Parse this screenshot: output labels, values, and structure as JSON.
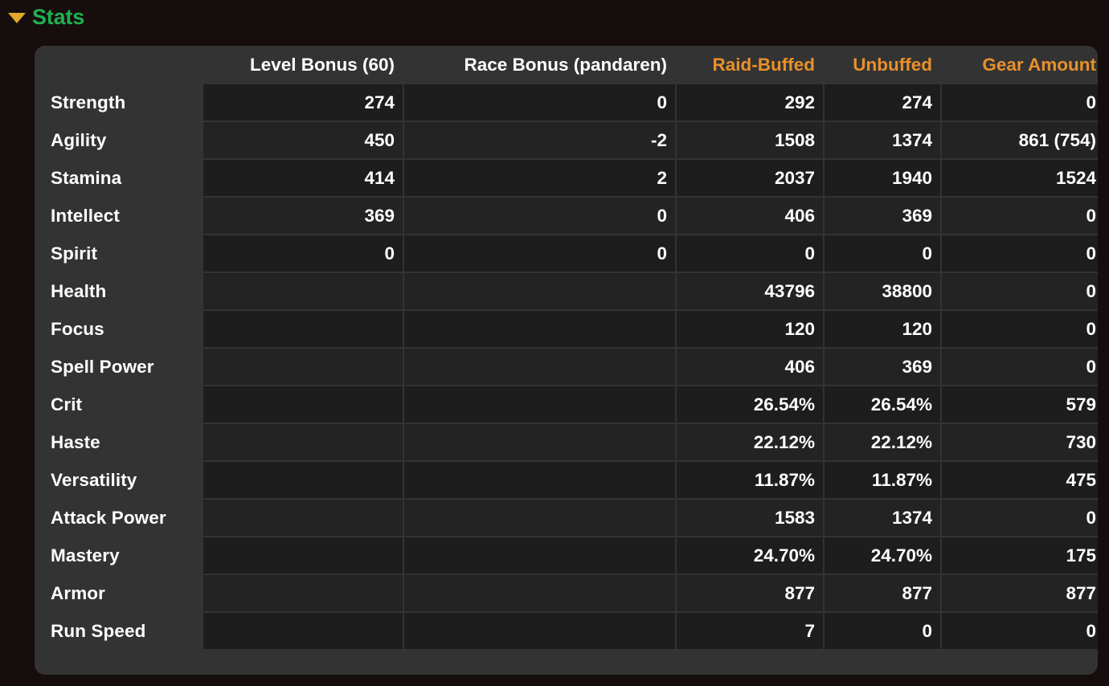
{
  "section": {
    "title": "Stats",
    "collapse_icon": "triangle-down-icon",
    "title_color": "#21b04f",
    "icon_color": "#e3a72a"
  },
  "table": {
    "columns": [
      {
        "label": "",
        "color": ""
      },
      {
        "label": "Level Bonus (60)",
        "color": "#ffffff"
      },
      {
        "label": "Race Bonus (pandaren)",
        "color": "#ffffff"
      },
      {
        "label": "Raid-Buffed",
        "color": "#e8912a"
      },
      {
        "label": "Unbuffed",
        "color": "#e8912a"
      },
      {
        "label": "Gear Amount",
        "color": "#e8912a"
      }
    ],
    "rows": [
      {
        "label": "Strength",
        "level_bonus": "274",
        "race_bonus": "0",
        "raid_buffed": "292",
        "unbuffed": "274",
        "gear_amount": "0"
      },
      {
        "label": "Agility",
        "level_bonus": "450",
        "race_bonus": "-2",
        "raid_buffed": "1508",
        "unbuffed": "1374",
        "gear_amount": "861 (754)"
      },
      {
        "label": "Stamina",
        "level_bonus": "414",
        "race_bonus": "2",
        "raid_buffed": "2037",
        "unbuffed": "1940",
        "gear_amount": "1524"
      },
      {
        "label": "Intellect",
        "level_bonus": "369",
        "race_bonus": "0",
        "raid_buffed": "406",
        "unbuffed": "369",
        "gear_amount": "0"
      },
      {
        "label": "Spirit",
        "level_bonus": "0",
        "race_bonus": "0",
        "raid_buffed": "0",
        "unbuffed": "0",
        "gear_amount": "0"
      },
      {
        "label": "Health",
        "level_bonus": "",
        "race_bonus": "",
        "raid_buffed": "43796",
        "unbuffed": "38800",
        "gear_amount": "0"
      },
      {
        "label": "Focus",
        "level_bonus": "",
        "race_bonus": "",
        "raid_buffed": "120",
        "unbuffed": "120",
        "gear_amount": "0"
      },
      {
        "label": "Spell Power",
        "level_bonus": "",
        "race_bonus": "",
        "raid_buffed": "406",
        "unbuffed": "369",
        "gear_amount": "0"
      },
      {
        "label": "Crit",
        "level_bonus": "",
        "race_bonus": "",
        "raid_buffed": "26.54%",
        "unbuffed": "26.54%",
        "gear_amount": "579"
      },
      {
        "label": "Haste",
        "level_bonus": "",
        "race_bonus": "",
        "raid_buffed": "22.12%",
        "unbuffed": "22.12%",
        "gear_amount": "730"
      },
      {
        "label": "Versatility",
        "level_bonus": "",
        "race_bonus": "",
        "raid_buffed": "11.87%",
        "unbuffed": "11.87%",
        "gear_amount": "475"
      },
      {
        "label": "Attack Power",
        "level_bonus": "",
        "race_bonus": "",
        "raid_buffed": "1583",
        "unbuffed": "1374",
        "gear_amount": "0"
      },
      {
        "label": "Mastery",
        "level_bonus": "",
        "race_bonus": "",
        "raid_buffed": "24.70%",
        "unbuffed": "24.70%",
        "gear_amount": "175"
      },
      {
        "label": "Armor",
        "level_bonus": "",
        "race_bonus": "",
        "raid_buffed": "877",
        "unbuffed": "877",
        "gear_amount": "877"
      },
      {
        "label": "Run Speed",
        "level_bonus": "",
        "race_bonus": "",
        "raid_buffed": "7",
        "unbuffed": "0",
        "gear_amount": "0"
      }
    ]
  },
  "colors": {
    "page_background": "#150e0d",
    "panel_background": "#333333",
    "cell_background": "#1d1d1d",
    "cell_background_alt": "#232323",
    "text": "#ffffff",
    "accent_gold": "#e8912a",
    "accent_green": "#21b04f"
  }
}
